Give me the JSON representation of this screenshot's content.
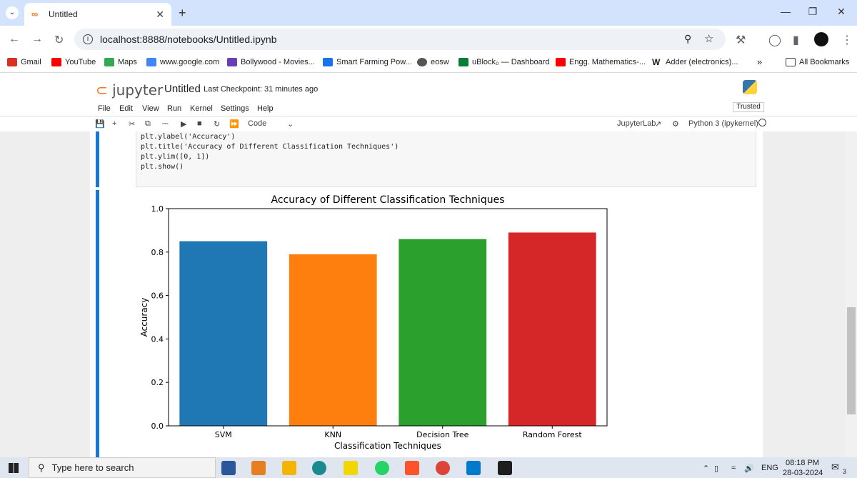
{
  "browser": {
    "tab_title": "Untitled",
    "url": "localhost:8888/notebooks/Untitled.ipynb",
    "bookmarks": [
      {
        "label": "Gmail",
        "color": "#d93025"
      },
      {
        "label": "YouTube",
        "color": "#ff0000"
      },
      {
        "label": "Maps",
        "color": "#34a853"
      },
      {
        "label": "www.google.com",
        "color": "#4285f4"
      },
      {
        "label": "Bollywood - Movies...",
        "color": "#6a3fb5"
      },
      {
        "label": "Smart Farming Pow...",
        "color": "#1a73e8"
      },
      {
        "label": "eosw",
        "color": "#555555"
      },
      {
        "label": "uBlock₀ — Dashboard",
        "color": "#0a7d3b"
      },
      {
        "label": "Engg. Mathematics-...",
        "color": "#ff0000"
      },
      {
        "label": "Adder (electronics)...",
        "color": "#333333"
      }
    ],
    "all_bookmarks": "All Bookmarks"
  },
  "jupyter": {
    "logo": "jupyter",
    "notebook_title": "Untitled",
    "checkpoint": "Last Checkpoint: 31 minutes ago",
    "menus": [
      "File",
      "Edit",
      "View",
      "Run",
      "Kernel",
      "Settings",
      "Help"
    ],
    "trusted": "Trusted",
    "cell_type": "Code",
    "jupyterlab_link": "JupyterLab",
    "kernel": "Python 3 (ipykernel)"
  },
  "code": {
    "line1": "plt.ylabel('Accuracy')",
    "line2": "plt.title('Accuracy of Different Classification Techniques')",
    "line3": "plt.ylim([0, 1])",
    "line4": "plt.show()"
  },
  "chart_data": {
    "type": "bar",
    "title": "Accuracy of Different Classification Techniques",
    "xlabel": "Classification Techniques",
    "ylabel": "Accuracy",
    "categories": [
      "SVM",
      "KNN",
      "Decision Tree",
      "Random Forest"
    ],
    "values": [
      0.85,
      0.79,
      0.86,
      0.89
    ],
    "colors": [
      "#1f77b4",
      "#ff7f0e",
      "#2ca02c",
      "#d62728"
    ],
    "ylim": [
      0,
      1
    ],
    "yticks": [
      "0.0",
      "0.2",
      "0.4",
      "0.6",
      "0.8",
      "1.0"
    ],
    "grid": false
  },
  "taskbar": {
    "search_placeholder": "Type here to search",
    "lang": "ENG",
    "time": "08:18 PM",
    "date": "28-03-2024",
    "notif_count": "3"
  }
}
